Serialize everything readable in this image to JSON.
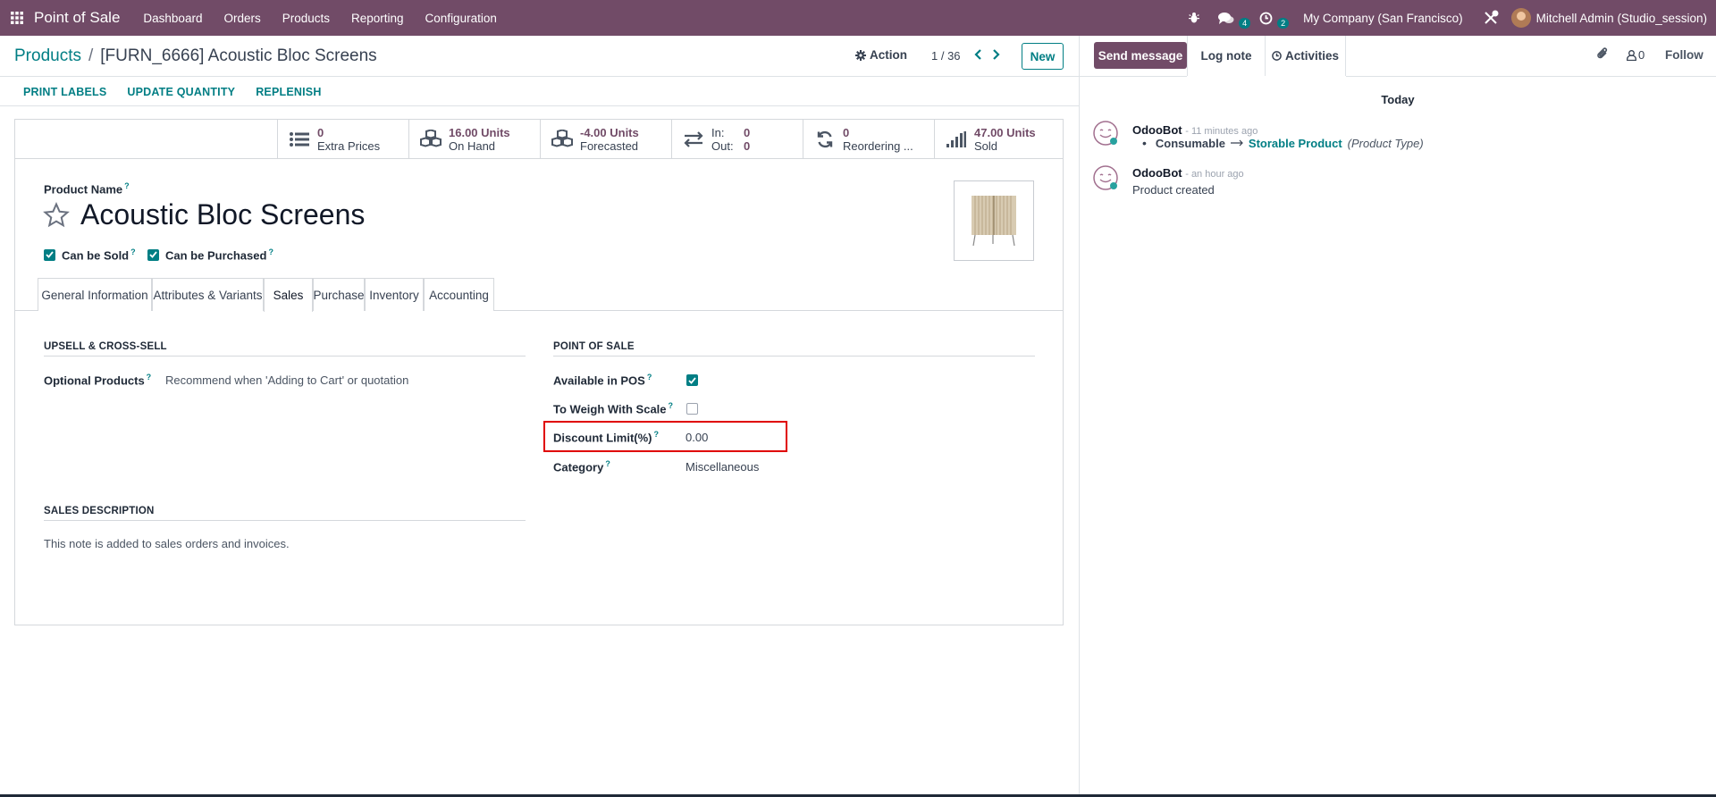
{
  "navbar": {
    "app_name": "Point of Sale",
    "menu": [
      "Dashboard",
      "Orders",
      "Products",
      "Reporting",
      "Configuration"
    ],
    "messages_count": "4",
    "activities_count": "2",
    "company": "My Company (San Francisco)",
    "user": "Mitchell Admin (Studio_session)",
    "accent_color": "#714b67"
  },
  "control": {
    "breadcrumb_parent": "Products",
    "breadcrumb_sep": "/",
    "breadcrumb_current": "[FURN_6666] Acoustic Bloc Screens",
    "action_label": "Action",
    "pager": "1 / 36",
    "new_label": "New"
  },
  "header_buttons": [
    "PRINT LABELS",
    "UPDATE QUANTITY",
    "REPLENISH"
  ],
  "stats": {
    "extra_prices": {
      "value": "0",
      "label": "Extra Prices",
      "icon": "list-icon"
    },
    "on_hand": {
      "value": "16.00 Units",
      "label": "On Hand",
      "icon": "cubes-icon"
    },
    "forecasted": {
      "value": "-4.00 Units",
      "label": "Forecasted",
      "icon": "cubes-icon"
    },
    "in_out": {
      "in_label": "In:",
      "in_value": "0",
      "out_label": "Out:",
      "out_value": "0",
      "icon": "exchange-icon"
    },
    "reordering": {
      "value": "0",
      "label": "Reordering ...",
      "icon": "refresh-icon"
    },
    "sold": {
      "value": "47.00 Units",
      "label": "Sold",
      "icon": "signal-icon"
    }
  },
  "product": {
    "name_label": "Product Name",
    "qmark": "?",
    "name": "Acoustic Bloc Screens",
    "can_be_sold_label": "Can be Sold",
    "can_be_sold": true,
    "can_be_purchased_label": "Can be Purchased",
    "can_be_purchased": true
  },
  "tabs": [
    "General Information",
    "Attributes & Variants",
    "Sales",
    "Purchase",
    "Inventory",
    "Accounting"
  ],
  "active_tab": "Sales",
  "sales": {
    "upsell_title": "UPSELL & CROSS-SELL",
    "optional_products_label": "Optional Products",
    "optional_products_placeholder": "Recommend when 'Adding to Cart' or quotation",
    "pos_title": "POINT OF SALE",
    "available_in_pos_label": "Available in POS",
    "available_in_pos": true,
    "to_weigh_label": "To Weigh With Scale",
    "to_weigh": false,
    "discount_limit_label": "Discount Limit(%)",
    "discount_limit_value": "0.00",
    "category_label": "Category",
    "category_value": "Miscellaneous",
    "sales_description_title": "SALES DESCRIPTION",
    "sales_description_placeholder": "This note is added to sales orders and invoices."
  },
  "chatter": {
    "send_message": "Send message",
    "log_note": "Log note",
    "activities": "Activities",
    "followers_count": "0",
    "follow": "Follow",
    "today": "Today",
    "messages": [
      {
        "author": "OdooBot",
        "time": "- 11 minutes ago",
        "old_value": "Consumable",
        "new_value": "Storable Product",
        "field": "(Product Type)"
      },
      {
        "author": "OdooBot",
        "time": "- an hour ago",
        "body": "Product created"
      }
    ]
  }
}
